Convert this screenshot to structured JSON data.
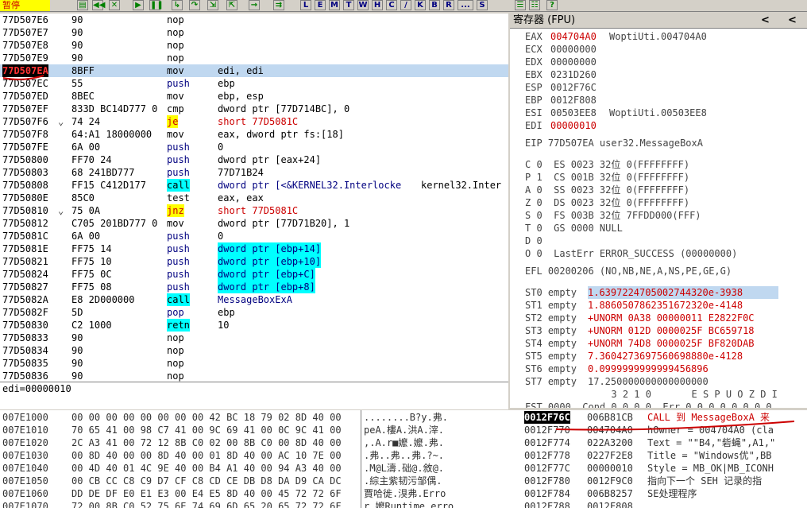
{
  "toolbar": {
    "status": "暂停",
    "letters": [
      "L",
      "E",
      "M",
      "T",
      "W",
      "H",
      "C",
      "/",
      "K",
      "B",
      "R",
      "...",
      "S"
    ]
  },
  "cpu": {
    "rows": [
      {
        "addr": "77D507E6",
        "hex": "90",
        "mn": "nop",
        "op": ""
      },
      {
        "addr": "77D507E7",
        "hex": "90",
        "mn": "nop",
        "op": ""
      },
      {
        "addr": "77D507E8",
        "hex": "90",
        "mn": "nop",
        "op": ""
      },
      {
        "addr": "77D507E9",
        "hex": "90",
        "mn": "nop",
        "op": ""
      },
      {
        "addr": "77D507EA",
        "hex": "8BFF",
        "mn": "mov",
        "op": "edi, edi",
        "sel": true
      },
      {
        "addr": "77D507EC",
        "hex": "55",
        "mn": "push",
        "op": "ebp"
      },
      {
        "addr": "77D507ED",
        "hex": "8BEC",
        "mn": "mov",
        "op": "ebp, esp"
      },
      {
        "addr": "77D507EF",
        "hex": "833D BC14D777 0",
        "mn": "cmp",
        "op": "dword ptr [77D714BC], 0"
      },
      {
        "addr": "77D507F6",
        "hex": "74 24",
        "mn": "je",
        "op": "short 77D5081C",
        "mark": "⌄",
        "jmp": true
      },
      {
        "addr": "77D507F8",
        "hex": "64:A1 18000000",
        "mn": "mov",
        "op": "eax, dword ptr fs:[18]"
      },
      {
        "addr": "77D507FE",
        "hex": "6A 00",
        "mn": "push",
        "op": "0"
      },
      {
        "addr": "77D50800",
        "hex": "FF70 24",
        "mn": "push",
        "op": "dword ptr [eax+24]"
      },
      {
        "addr": "77D50803",
        "hex": "68 241BD777",
        "mn": "push",
        "op": "77D71B24"
      },
      {
        "addr": "77D50808",
        "hex": "FF15 C412D177",
        "mn": "call",
        "op": "dword ptr [<&KERNEL32.Interlocke",
        "extra": "kernel32.Inter",
        "call": true
      },
      {
        "addr": "77D5080E",
        "hex": "85C0",
        "mn": "test",
        "op": "eax, eax"
      },
      {
        "addr": "77D50810",
        "hex": "75 0A",
        "mn": "jnz",
        "op": "short 77D5081C",
        "mark": "⌄",
        "jmp": true
      },
      {
        "addr": "77D50812",
        "hex": "C705 201BD777 0",
        "mn": "mov",
        "op": "dword ptr [77D71B20], 1"
      },
      {
        "addr": "77D5081C",
        "hex": "6A 00",
        "mn": "push",
        "op": "0"
      },
      {
        "addr": "77D5081E",
        "hex": "FF75 14",
        "mn": "push",
        "op": "dword ptr [ebp+14]",
        "cy": true
      },
      {
        "addr": "77D50821",
        "hex": "FF75 10",
        "mn": "push",
        "op": "dword ptr [ebp+10]",
        "cy": true
      },
      {
        "addr": "77D50824",
        "hex": "FF75 0C",
        "mn": "push",
        "op": "dword ptr [ebp+C]",
        "cy": true
      },
      {
        "addr": "77D50827",
        "hex": "FF75 08",
        "mn": "push",
        "op": "dword ptr [ebp+8]",
        "cy": true
      },
      {
        "addr": "77D5082A",
        "hex": "E8 2D000000",
        "mn": "call",
        "op": "MessageBoxExA",
        "call": true
      },
      {
        "addr": "77D5082F",
        "hex": "5D",
        "mn": "pop",
        "op": "ebp"
      },
      {
        "addr": "77D50830",
        "hex": "C2 1000",
        "mn": "retn",
        "op": "10",
        "ret": true
      },
      {
        "addr": "77D50833",
        "hex": "90",
        "mn": "nop",
        "op": ""
      },
      {
        "addr": "77D50834",
        "hex": "90",
        "mn": "nop",
        "op": ""
      },
      {
        "addr": "77D50835",
        "hex": "90",
        "mn": "nop",
        "op": ""
      },
      {
        "addr": "77D50836",
        "hex": "90",
        "mn": "nop",
        "op": ""
      }
    ]
  },
  "info": {
    "text": "edi=00000010"
  },
  "registers": {
    "title": "寄存器 (FPU)",
    "nav_left": "<",
    "nav_right": "<",
    "gp": [
      {
        "name": "EAX",
        "val": "004704A0",
        "note": "WoptiUti.004704A0",
        "red": true
      },
      {
        "name": "ECX",
        "val": "00000000",
        "note": ""
      },
      {
        "name": "EDX",
        "val": "00000000",
        "note": ""
      },
      {
        "name": "EBX",
        "val": "0231D260",
        "note": ""
      },
      {
        "name": "ESP",
        "val": "0012F76C",
        "note": ""
      },
      {
        "name": "EBP",
        "val": "0012F808",
        "note": ""
      },
      {
        "name": "ESI",
        "val": "00503EE8",
        "note": "WoptiUti.00503EE8"
      },
      {
        "name": "EDI",
        "val": "00000010",
        "note": "",
        "red": true
      }
    ],
    "eip": "EIP 77D507EA user32.MessageBoxA",
    "flags": [
      "C 0  ES 0023 32位 0(FFFFFFFF)",
      "P 1  CS 001B 32位 0(FFFFFFFF)",
      "A 0  SS 0023 32位 0(FFFFFFFF)",
      "Z 0  DS 0023 32位 0(FFFFFFFF)",
      "S 0  FS 003B 32位 7FFDD000(FFF)",
      "T 0  GS 0000 NULL",
      "D 0",
      "O 0  LastErr ERROR_SUCCESS (00000000)"
    ],
    "efl": "EFL 00200206 (NO,NB,NE,A,NS,PE,GE,G)",
    "fpu": [
      {
        "name": "ST0 empty",
        "val": "1.6397224705002744320e-3938",
        "sel": true
      },
      {
        "name": "ST1 empty",
        "val": "1.8860507862351672320e-4148"
      },
      {
        "name": "ST2 empty",
        "val": "+UNORM 0A38 00000011 E2822F0C"
      },
      {
        "name": "ST3 empty",
        "val": "+UNORM 012D 0000025F BC659718"
      },
      {
        "name": "ST4 empty",
        "val": "+UNORM 74D8 0000025F BF820DAB"
      },
      {
        "name": "ST5 empty",
        "val": "7.3604273697560698880e-4128"
      },
      {
        "name": "ST6 empty",
        "val": "0.0999999999999456896"
      },
      {
        "name": "ST7 empty",
        "val": "17.250000000000000000",
        "dark": true
      }
    ],
    "fpu_hdr": "               3 2 1 0       E S P U O Z D I",
    "fst": "FST 0000  Cond 0 0 0 0  Err 0 0 0 0 0 0 0 0"
  },
  "dump": {
    "rows": [
      {
        "a": "007E1000",
        "h": "00 00 00 00 00 00 00 00 42 BC 18 79 02 8D 40 00",
        "s": "........B?y.弗."
      },
      {
        "a": "007E1010",
        "h": "70 65 41 00 98 C7 41 00 9C 69 41 00 0C 9C 41 00",
        "s": "peA.樓A.洪A.滓."
      },
      {
        "a": "007E1020",
        "h": "2C A3 41 00 72 12 8B C0 02 00 8B C0 00 8D 40 00",
        "s": ",.A.r■嬤.嬤.弗."
      },
      {
        "a": "007E1030",
        "h": "00 8D 40 00 00 8D 40 00 01 8D 40 00 AC 10 7E 00",
        "s": ".弗..弗..弗.?~."
      },
      {
        "a": "007E1040",
        "h": "00 4D 40 01 4C 9E 40 00 B4 A1 40 00 94 A3 40 00",
        "s": ".M@L濤.础@.敘@."
      },
      {
        "a": "007E1050",
        "h": "00 CB CC C8 C9 D7 CF C8 CD CE DB D8 DA D9 CA DC",
        "s": ".綜主紫韧污邹偶."
      },
      {
        "a": "007E1060",
        "h": "DD DE DF E0 E1 E3 00 E4 E5 8D 40 00 45 72 72 6F",
        "s": "賈哈徙.湨弗.Erro"
      },
      {
        "a": "007E1070",
        "h": "72 00 8B C0 52 75 6E 74 69 6D 65 20 65 72 72 6F",
        "s": "r.嬤Runtime erro"
      }
    ]
  },
  "stack": {
    "rows": [
      {
        "a": "0012F76C",
        "v": "006B81CB",
        "c": "CALL 到 MessageBoxA 来",
        "sel": true
      },
      {
        "a": "0012F770",
        "v": "004704A0",
        "c": "hOwner = 004704A0 (cla"
      },
      {
        "a": "0012F774",
        "v": "022A3200",
        "c": "Text = \"\"B4,\"砦蝇\",A1,\""
      },
      {
        "a": "0012F778",
        "v": "0227F2E8",
        "c": "Title = \"Windows优\",BB"
      },
      {
        "a": "0012F77C",
        "v": "00000010",
        "c": "Style = MB_OK|MB_ICONH"
      },
      {
        "a": "0012F780",
        "v": "0012F9C0",
        "c": "指向下一个 SEH 记录的指"
      },
      {
        "a": "0012F784",
        "v": "006B8257",
        "c": "SE处理程序"
      },
      {
        "a": "0012F788",
        "v": "0012F808",
        "c": ""
      }
    ]
  }
}
